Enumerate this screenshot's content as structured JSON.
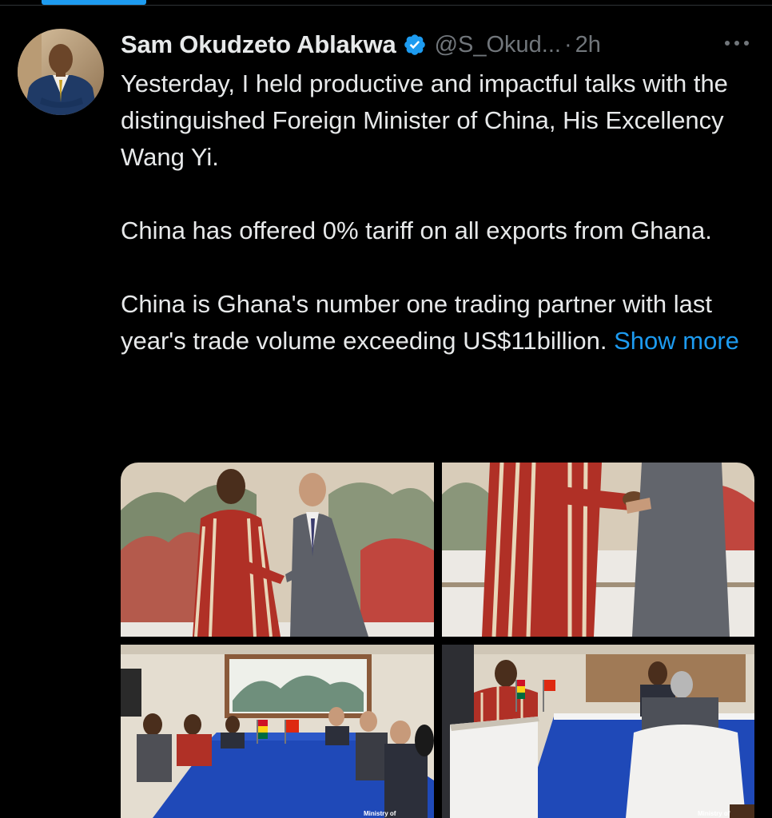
{
  "tweet": {
    "display_name": "Sam Okudzeto Ablakwa",
    "handle": "@S_Okud...",
    "separator": "·",
    "timestamp": "2h",
    "paragraphs": [
      "Yesterday, I held productive and impactful talks with the distinguished Foreign Minister of China, His Excellency Wang Yi.",
      "China has offered 0% tariff on all exports from Ghana."
    ],
    "last_paragraph": "China is Ghana's number one trading partner with last year's trade volume exceeding US$11billion.",
    "show_more_label": "Show more"
  },
  "media": {
    "photo_count": 4,
    "watermark": "Ministry of"
  },
  "colors": {
    "background": "#000000",
    "text": "#e7e9ea",
    "muted": "#71767b",
    "accent": "#1d9bf0"
  },
  "icons": {
    "verified": "verified-badge-icon",
    "more": "more-options-icon"
  }
}
